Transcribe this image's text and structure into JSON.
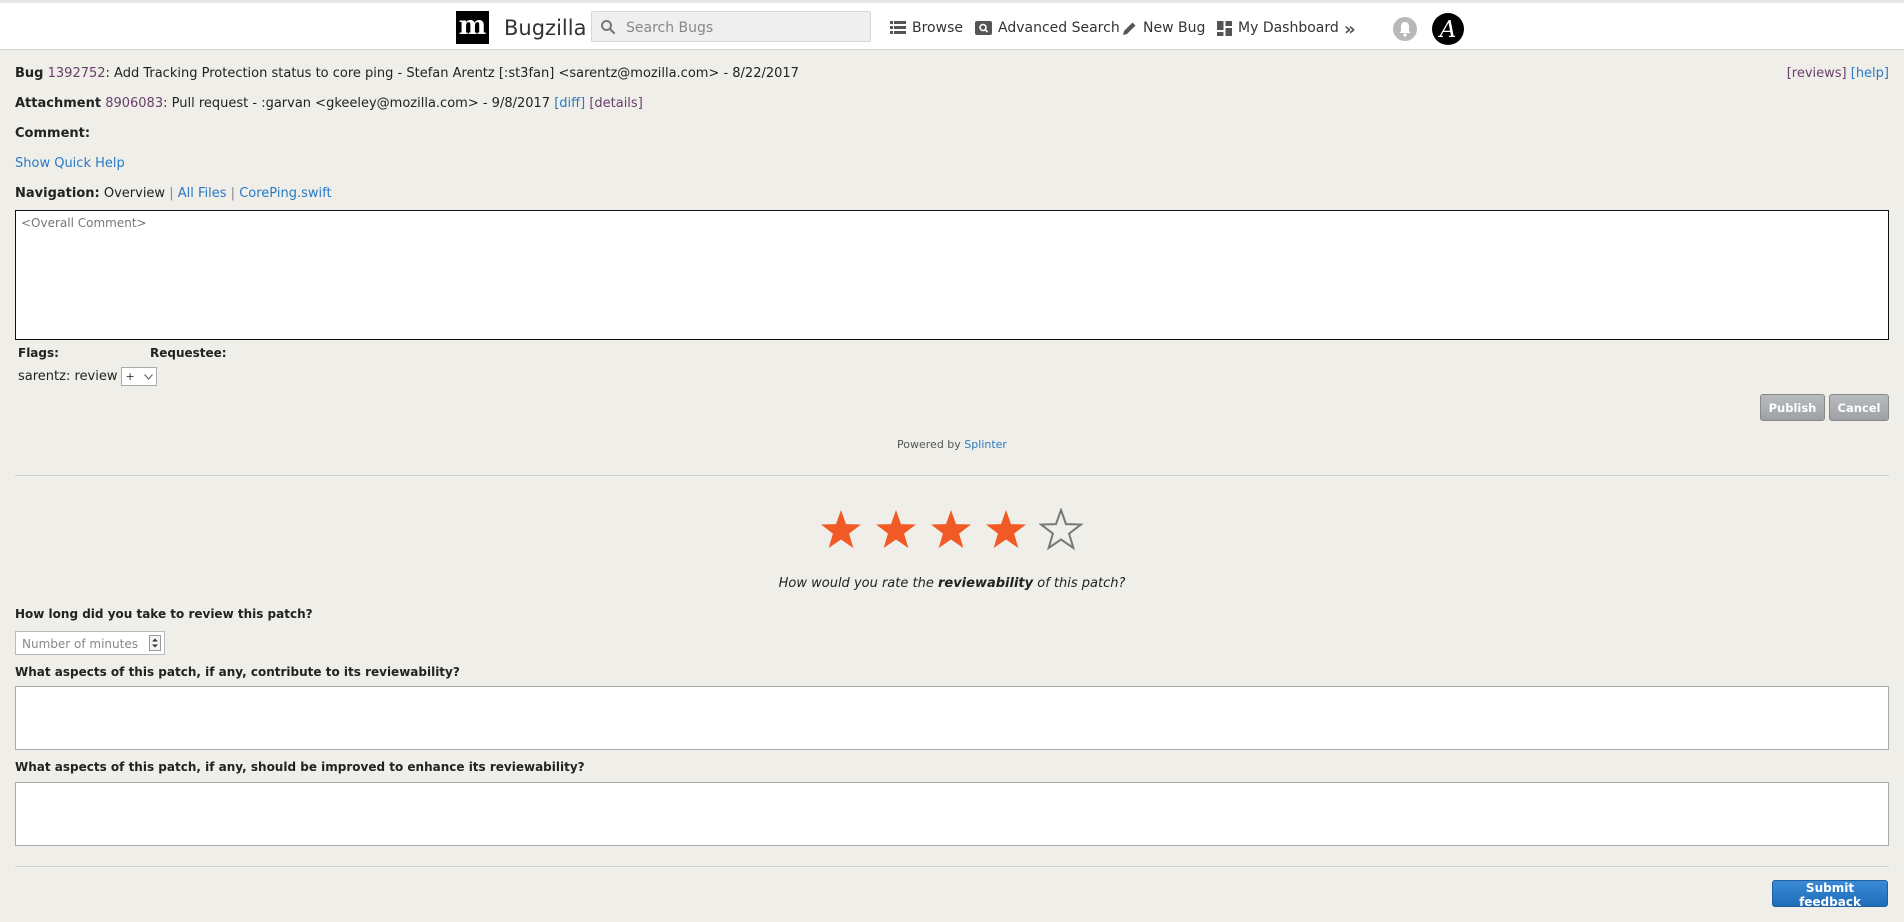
{
  "header": {
    "logo_letter": "m",
    "brand": "Bugzilla",
    "search_placeholder": "Search Bugs",
    "nav": {
      "browse": "Browse",
      "advanced_search": "Advanced Search",
      "new_bug": "New Bug",
      "my_dashboard": "My Dashboard"
    },
    "more": "»",
    "avatar_letter": "A"
  },
  "bug": {
    "prefix": "Bug",
    "id": "1392752",
    "summary": ": Add Tracking Protection status to core ping - Stefan Arentz [:st3fan] <sarentz@mozilla.com> - 8/22/2017"
  },
  "links": {
    "reviews": "[reviews]",
    "help": "[help]"
  },
  "attachment": {
    "prefix": "Attachment",
    "id": "8906083",
    "summary": ": Pull request - :garvan <gkeeley@mozilla.com> - 9/8/2017",
    "diff": "[diff]",
    "details": "[details]"
  },
  "comment_label": "Comment:",
  "quick_help": "Show Quick Help",
  "navigation": {
    "label": "Navigation:",
    "current": "Overview",
    "sep": "|",
    "all_files": "All Files",
    "file": "CorePing.swift"
  },
  "overall_comment_placeholder": "<Overall Comment>",
  "flags": {
    "flags_label": "Flags:",
    "requestee_label": "Requestee:",
    "flag_name": "sarentz: review",
    "flag_value": "+"
  },
  "buttons": {
    "publish": "Publish",
    "cancel": "Cancel",
    "submit_feedback": "Submit feedback"
  },
  "powered": {
    "text": "Powered by",
    "link": "Splinter"
  },
  "rating": {
    "value": 4,
    "max": 5,
    "color": "#f15a24",
    "question_pre": "How would you rate the",
    "question_bold": "reviewability",
    "question_post": "of this patch?"
  },
  "feedback": {
    "time_question": "How long did you take to review this patch?",
    "minutes_placeholder": "Number of minutes",
    "contribute_question": "What aspects of this patch, if any, contribute to its reviewability?",
    "improve_question": "What aspects of this patch, if any, should be improved to enhance its reviewability?"
  }
}
